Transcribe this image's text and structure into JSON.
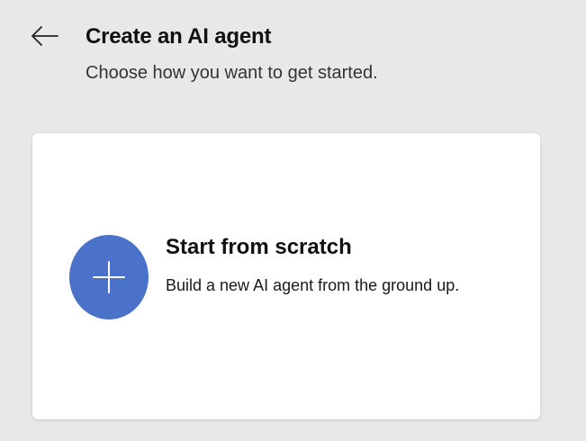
{
  "header": {
    "back_icon": "arrow-left-icon",
    "title": "Create an AI agent",
    "subtitle": "Choose how you want to get started."
  },
  "options": [
    {
      "icon": "plus-icon",
      "title": "Start from scratch",
      "description": "Build a new AI agent from the ground up."
    }
  ],
  "colors": {
    "background": "#e8e8e8",
    "card": "#ffffff",
    "accent": "#4a72c8"
  }
}
